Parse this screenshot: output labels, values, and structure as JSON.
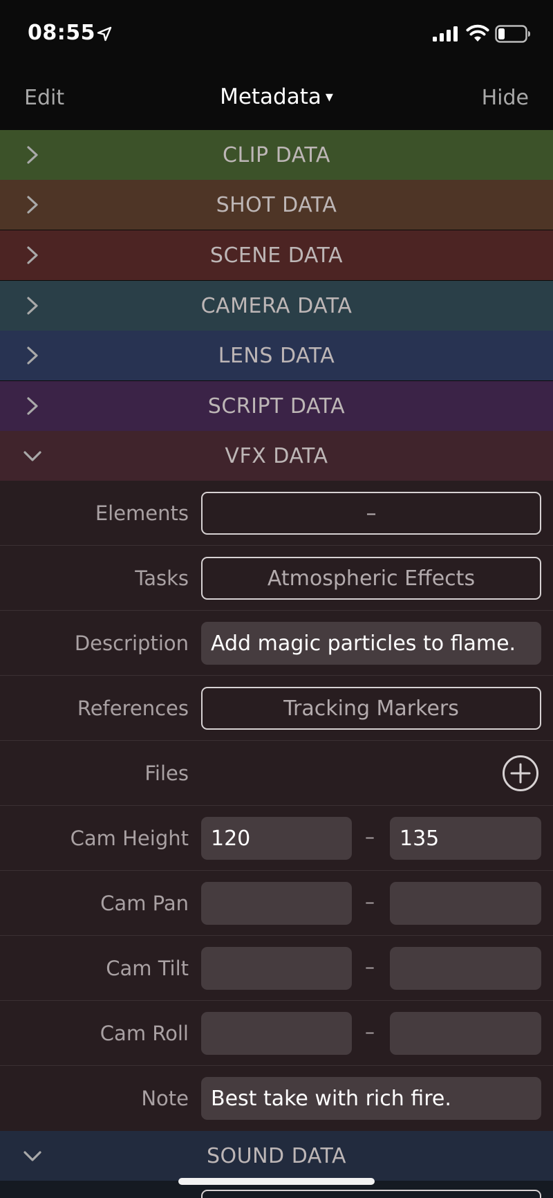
{
  "status_bar": {
    "time": "08:55",
    "icons": [
      "location-arrow-icon",
      "cellular-signal-icon",
      "wifi-icon",
      "battery-icon"
    ]
  },
  "nav": {
    "edit_label": "Edit",
    "title": "Metadata",
    "title_arrow": "▾",
    "hide_label": "Hide"
  },
  "sections": [
    {
      "label": "CLIP DATA",
      "color": "#3c5229",
      "expanded": false
    },
    {
      "label": "SHOT DATA",
      "color": "#4e3526",
      "expanded": false
    },
    {
      "label": "SCENE DATA",
      "color": "#4c2423",
      "expanded": false
    },
    {
      "label": "CAMERA DATA",
      "color": "#2a3f48",
      "expanded": false
    },
    {
      "label": "LENS DATA",
      "color": "#283352",
      "expanded": false
    },
    {
      "label": "SCRIPT DATA",
      "color": "#3b2347",
      "expanded": false
    },
    {
      "label": "VFX DATA",
      "color": "#40242c",
      "expanded": true
    },
    {
      "label": "SOUND DATA",
      "color": "#222b3e",
      "expanded": true
    }
  ],
  "vfx": {
    "elements": {
      "label": "Elements",
      "value": "–"
    },
    "tasks": {
      "label": "Tasks",
      "value": "Atmospheric Effects"
    },
    "description": {
      "label": "Description",
      "value": "Add magic particles to flame."
    },
    "references": {
      "label": "References",
      "value": "Tracking Markers"
    },
    "files": {
      "label": "Files"
    },
    "cam_height": {
      "label": "Cam Height",
      "from": "120",
      "to": "135"
    },
    "cam_pan": {
      "label": "Cam Pan",
      "from": "",
      "to": ""
    },
    "cam_tilt": {
      "label": "Cam Tilt",
      "from": "",
      "to": ""
    },
    "cam_roll": {
      "label": "Cam Roll",
      "from": "",
      "to": ""
    },
    "note": {
      "label": "Note",
      "value": "Best take with rich fire."
    },
    "range_separator": "–"
  }
}
